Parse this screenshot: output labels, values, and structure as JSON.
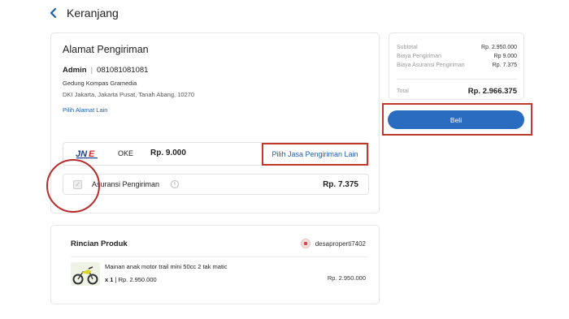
{
  "header": {
    "title": "Keranjang",
    "back_icon": "chevron-left-icon"
  },
  "shipping": {
    "section_title": "Alamat Pengiriman",
    "recipient_name": "Admin",
    "separator": "|",
    "phone": "081081081081",
    "address_line1": "Gedung Kompas Gramedia",
    "address_line2": "DKI Jakarta, Jakarta Pusat, Tanah Abang, 10270",
    "change_address_link": "Pilih Alamat Lain",
    "courier": {
      "logo": "JNE",
      "service": "OKE",
      "price": "Rp. 9.000",
      "change_courier_link": "Pilih Jasa Pengiriman Lain"
    },
    "insurance": {
      "label": "Asuransi Pengiriman",
      "price": "Rp. 7.375",
      "checked": true
    }
  },
  "product_section": {
    "title": "Rincian Produk",
    "seller": "desaproperti7402",
    "item": {
      "name": "Mainan anak motor trail mini 50cc 2 tak matic",
      "qty": "x 1",
      "separator": "|",
      "unit_price": "Rp. 2.950.000",
      "line_total": "Rp. 2.950.000"
    }
  },
  "summary": {
    "subtotal_label": "Subtotal",
    "subtotal_value": "Rp. 2.950.000",
    "shipping_label": "Biaya Pengiriman",
    "shipping_value": "Rp 9.000",
    "insurance_label": "Biaya Asuransi Pengiriman",
    "insurance_value": "Rp. 7.375",
    "total_label": "Total",
    "total_value": "Rp. 2.966.375"
  },
  "buy_button": {
    "label": "Beli"
  },
  "colors": {
    "accent_blue": "#2a6cc0",
    "link_blue": "#1f5fb0",
    "highlight_red": "#c0392b"
  }
}
